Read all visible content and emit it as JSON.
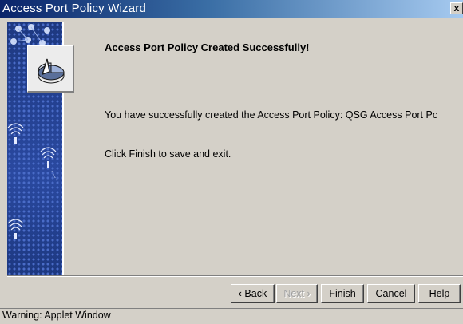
{
  "window": {
    "title": "Access Port Policy Wizard",
    "close_label": "x"
  },
  "sidebar": {
    "icons": [
      "network-nodes-icon",
      "wireless-signal-icon",
      "wireless-signal-icon",
      "wireless-signal-icon"
    ]
  },
  "main": {
    "icon": "pie-chart-icon",
    "heading": "Access Port Policy Created Successfully!",
    "message_line": "You have successfully created the Access Port Policy: QSG Access Port Pc",
    "instruction": "Click Finish to save and exit."
  },
  "buttons": {
    "back": "‹ Back",
    "next": "Next ›",
    "finish": "Finish",
    "cancel": "Cancel",
    "help": "Help"
  },
  "status": {
    "text": "Warning: Applet Window"
  },
  "colors": {
    "titlebar_start": "#0a246a",
    "titlebar_end": "#a6caf0",
    "sidebar": "#1f3a8a",
    "dialog_bg": "#d4d0c8"
  }
}
